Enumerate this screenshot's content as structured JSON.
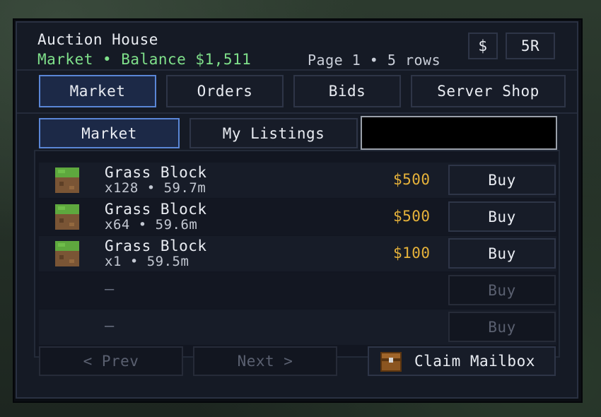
{
  "header": {
    "title": "Auction House",
    "subtitle": "Market • Balance $1,511",
    "page_info": "Page 1 • 5 rows",
    "currency_button": "$",
    "sort_button": "5R"
  },
  "tabs": [
    {
      "label": "Market",
      "active": true
    },
    {
      "label": "Orders",
      "active": false
    },
    {
      "label": "Bids",
      "active": false
    },
    {
      "label": "Server Shop",
      "active": false
    }
  ],
  "subtabs": [
    {
      "label": "Market",
      "active": true
    },
    {
      "label": "My Listings",
      "active": false
    }
  ],
  "search": {
    "value": "",
    "placeholder": ""
  },
  "listings": [
    {
      "icon": "grass-block-icon",
      "name": "Grass Block",
      "meta": "x128 • 59.7m",
      "price": "$500",
      "action": "Buy"
    },
    {
      "icon": "grass-block-icon",
      "name": "Grass Block",
      "meta": "x64 • 59.6m",
      "price": "$500",
      "action": "Buy"
    },
    {
      "icon": "grass-block-icon",
      "name": "Grass Block",
      "meta": "x1 • 59.5m",
      "price": "$100",
      "action": "Buy"
    },
    {
      "empty": "—",
      "action": "Buy"
    },
    {
      "empty": "—",
      "action": "Buy"
    }
  ],
  "footer": {
    "prev": "< Prev",
    "next": "Next >",
    "claim": "Claim Mailbox"
  },
  "colors": {
    "accent": "#5a86d6",
    "balance": "#7fe08a",
    "price": "#e6b23a"
  }
}
